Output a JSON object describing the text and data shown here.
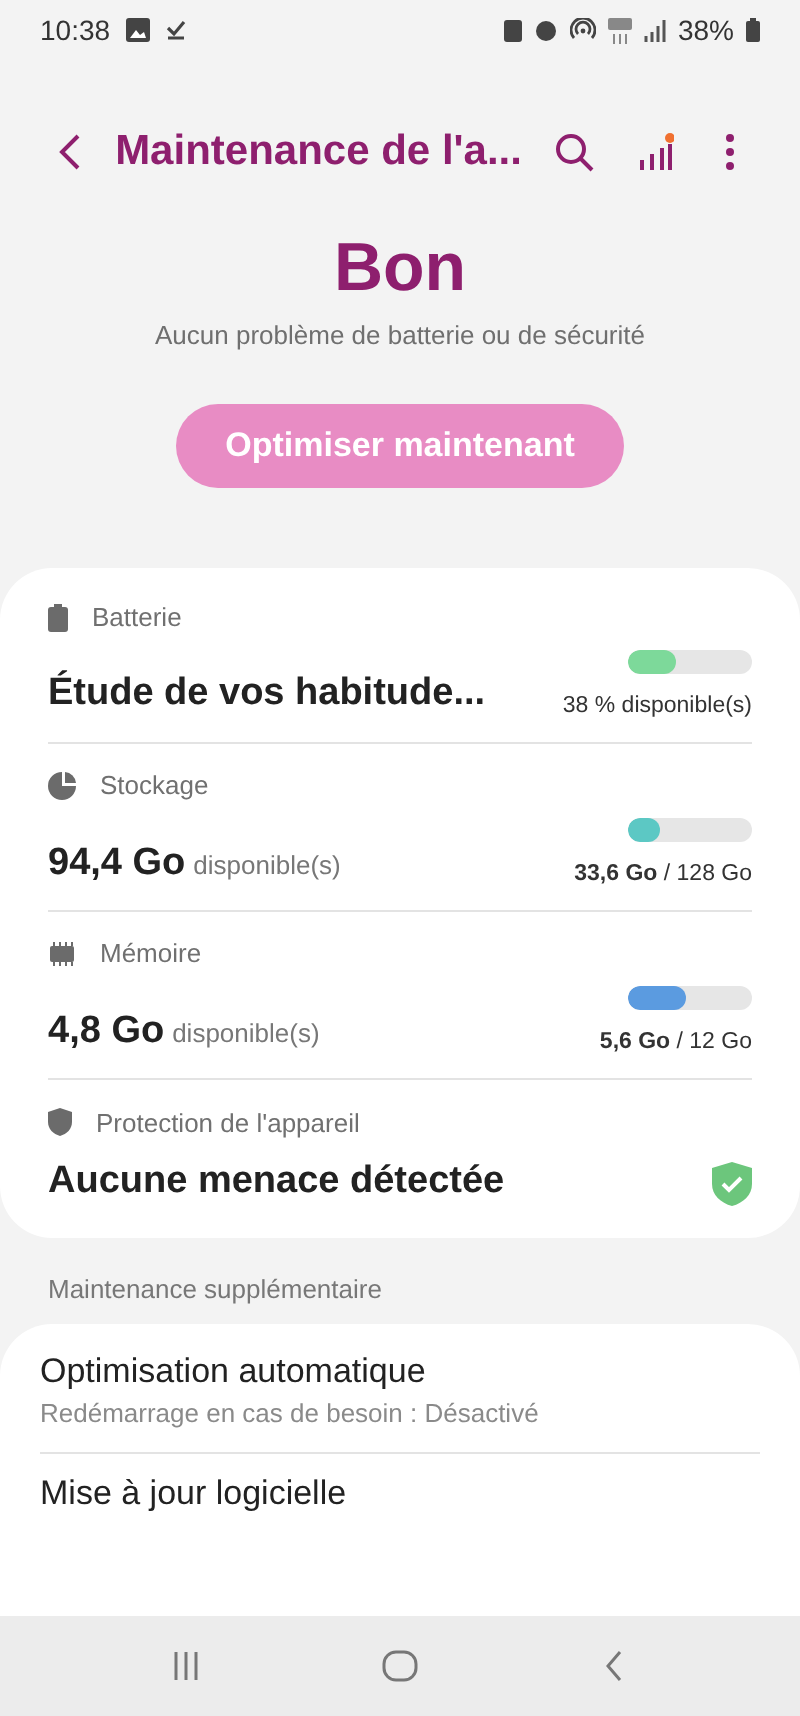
{
  "status_bar": {
    "time": "10:38",
    "battery": "38%"
  },
  "header": {
    "title": "Maintenance de l'a..."
  },
  "summary": {
    "status": "Bon",
    "message": "Aucun problème de batterie ou de sécurité",
    "button": "Optimiser maintenant"
  },
  "items": [
    {
      "kind": "meter",
      "label": "Batterie",
      "value": "Étude de vos habitude...",
      "level": 0.38,
      "color": "#7dd99a",
      "reading": "38 % disponible(s)"
    },
    {
      "kind": "meter",
      "label": "Stockage",
      "value": "94,4 Go",
      "suffix": "disponible(s)",
      "level": 0.26,
      "color": "#5cc8c4",
      "reading": "**33,6 Go** / 128 Go"
    },
    {
      "kind": "meter",
      "label": "Mémoire",
      "value": "4,8 Go",
      "suffix": "disponible(s)",
      "level": 0.47,
      "color": "#5b9be0",
      "reading": "**5,6 Go** / 12 Go"
    },
    {
      "kind": "status",
      "label": "Protection de l'appareil",
      "value": "Aucune menace détectée"
    }
  ],
  "section_label": "Maintenance supplémentaire",
  "extra": [
    {
      "title": "Optimisation automatique",
      "subtitle": "Redémarrage en cas de besoin : Désactivé"
    },
    {
      "title": "Mise à jour logicielle"
    }
  ]
}
